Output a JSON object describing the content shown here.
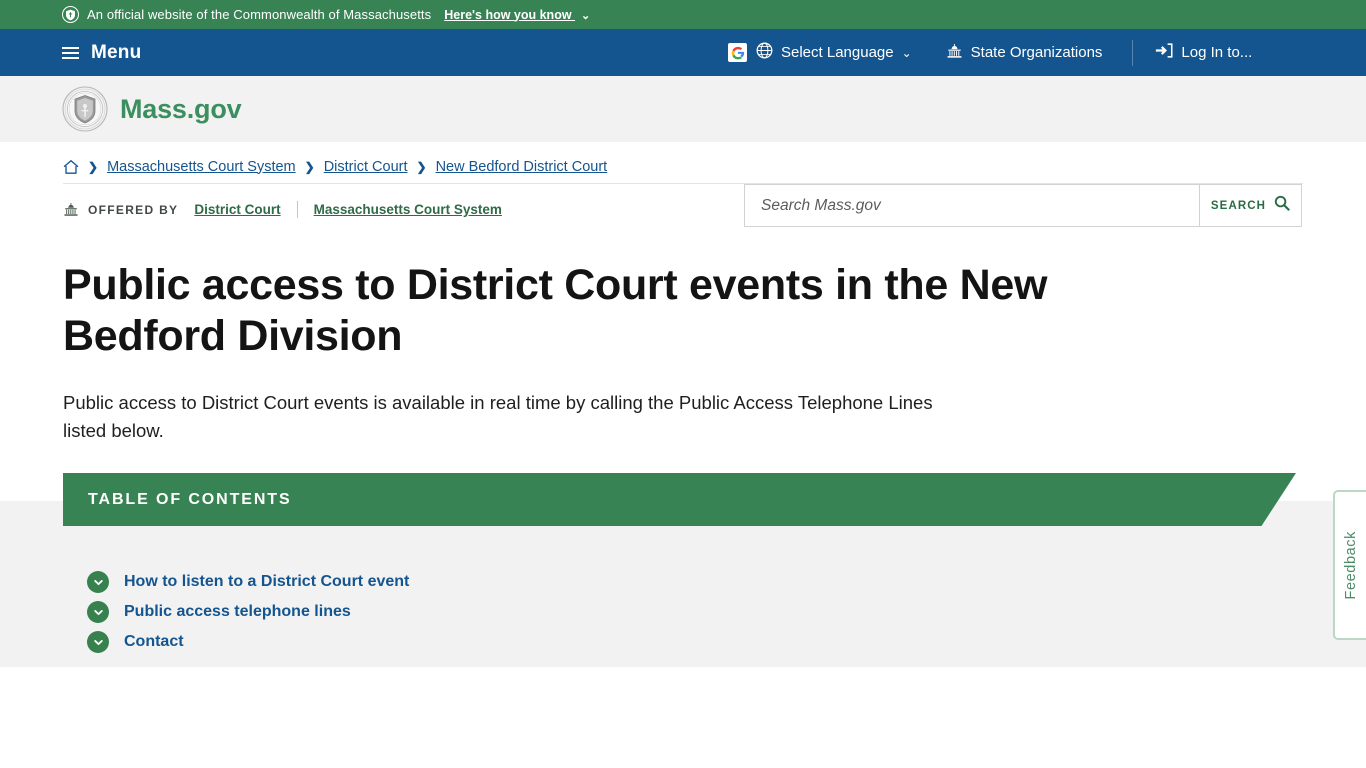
{
  "gov_banner": {
    "text": "An official website of the Commonwealth of Massachusetts",
    "how_you_know": "Here's how you know",
    "chevron": "⌄",
    "shield_icon": "shield-icon"
  },
  "mainnav": {
    "menu_label": "Menu",
    "items": [
      {
        "label": "Select Language",
        "icon": "globe-icon",
        "caret": "⌄",
        "google_mark": "G"
      },
      {
        "label": "State Organizations",
        "icon": "capitol-icon"
      },
      {
        "label": "Log In to...",
        "icon": "login-arrow-icon"
      }
    ]
  },
  "header": {
    "brand": "Mass.gov",
    "seal_icon": "massachusetts-state-seal"
  },
  "search": {
    "placeholder": "Search Mass.gov",
    "value": "",
    "button_label": "SEARCH",
    "button_icon": "magnifier-icon"
  },
  "breadcrumb": {
    "home_icon": "home-icon",
    "separator": "❯",
    "items": [
      "Massachusetts Court System",
      "District Court",
      "New Bedford District Court"
    ]
  },
  "offered_by": {
    "icon": "capitol-icon",
    "label": "OFFERED BY",
    "links": [
      "District Court",
      "Massachusetts Court System"
    ]
  },
  "page": {
    "title": "Public access to District Court events in the New Bedford Division",
    "intro": "Public access to District Court events is available in real time by calling the Public Access Telephone Lines listed below."
  },
  "table_of_contents": {
    "heading": "TABLE OF CONTENTS",
    "items": [
      "How to listen to a District Court event",
      "Public access telephone lines",
      "Contact"
    ],
    "bullet_icon": "chevron-down-circle-icon"
  },
  "feedback": {
    "label": "Feedback"
  },
  "colors": {
    "banner_green": "#388354",
    "nav_blue": "#14558f",
    "brand_green": "#3b8f5f",
    "link_blue": "#14558f",
    "offered_link_green": "#2f6b46",
    "gray_bg": "#f2f2f2",
    "feedback_border": "#bcd7c4",
    "feedback_text": "#4a8d67"
  }
}
